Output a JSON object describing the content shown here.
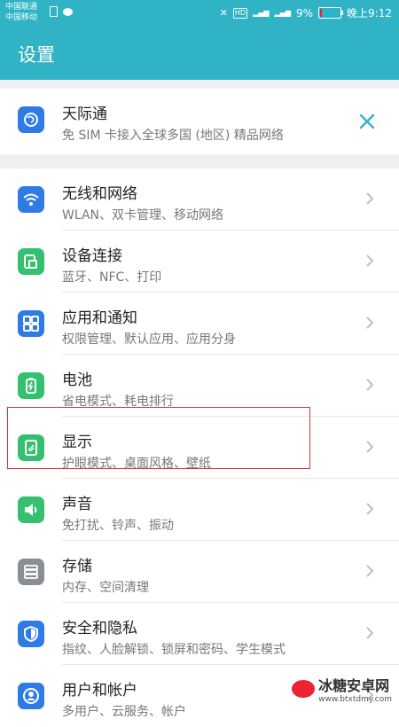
{
  "status": {
    "carrier1": "中国联通",
    "carrier2": "中国移动",
    "battery_text": "9%",
    "battery_level": 0.09,
    "time": "晚上9:12"
  },
  "header": {
    "title": "设置"
  },
  "promo": {
    "title": "天际通",
    "subtitle": "免 SIM 卡接入全球多国 (地区) 精品网络"
  },
  "items": [
    {
      "title": "无线和网络",
      "subtitle": "WLAN、双卡管理、移动网络",
      "icon": "wifi-icon",
      "color": "#2f7be6"
    },
    {
      "title": "设备连接",
      "subtitle": "蓝牙、NFC、打印",
      "icon": "device-connect-icon",
      "color": "#35c06f"
    },
    {
      "title": "应用和通知",
      "subtitle": "权限管理、默认应用、应用分身",
      "icon": "apps-grid-icon",
      "color": "#2f7be6"
    },
    {
      "title": "电池",
      "subtitle": "省电模式、耗电排行",
      "icon": "battery-icon",
      "color": "#35c06f"
    },
    {
      "title": "显示",
      "subtitle": "护眼模式、桌面风格、壁纸",
      "icon": "display-icon",
      "color": "#35c06f"
    },
    {
      "title": "声音",
      "subtitle": "免打扰、铃声、振动",
      "icon": "sound-icon",
      "color": "#35c06f"
    },
    {
      "title": "存储",
      "subtitle": "内存、空间清理",
      "icon": "storage-icon",
      "color": "#8a8f96"
    },
    {
      "title": "安全和隐私",
      "subtitle": "指纹、人脸解锁、锁屏和密码、学生模式",
      "icon": "shield-icon",
      "color": "#2f7be6"
    },
    {
      "title": "用户和帐户",
      "subtitle": "多用户、云服务、帐户",
      "icon": "user-icon",
      "color": "#2f7be6"
    }
  ],
  "watermark": {
    "name": "冰糖安卓网",
    "url": "www.btxtdmy.com"
  }
}
